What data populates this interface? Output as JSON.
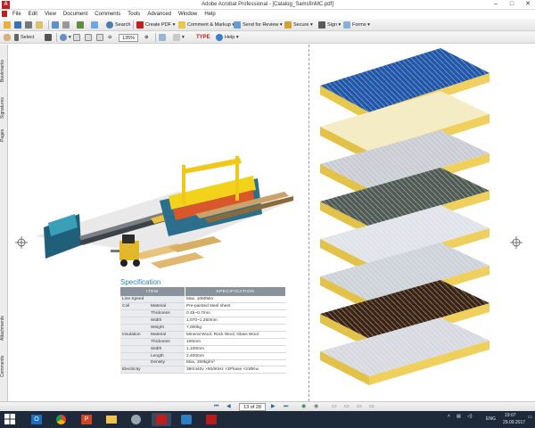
{
  "window": {
    "title": "Adobe Acrobat Professional - [Catalog_SamsfinMC.pdf]",
    "minimize": "–",
    "maximize": "□",
    "close": "✕"
  },
  "menu": [
    "File",
    "Edit",
    "View",
    "Document",
    "Comments",
    "Tools",
    "Advanced",
    "Window",
    "Help"
  ],
  "toolbar1": {
    "search": "Search",
    "create_pdf": "Create PDF",
    "comment_markup": "Comment & Markup",
    "send_for_review": "Send for Review",
    "secure": "Secure",
    "sign": "Sign",
    "forms": "Forms"
  },
  "toolbar2": {
    "select": "Select",
    "zoom": "135%",
    "help": "Help"
  },
  "left_tabs": [
    "Bookmarks",
    "Signatures",
    "Pages",
    "Attachments",
    "Comments"
  ],
  "spec": {
    "title": "Specification",
    "headers": [
      "ITEM",
      "SPECIFICATION"
    ],
    "rows": [
      [
        "Line Speed",
        "",
        "Max. 10M/Min"
      ],
      [
        "Coil",
        "Material",
        "Pre-painted steel sheet"
      ],
      [
        "",
        "Thickness",
        "0.45~0.7mm"
      ],
      [
        "",
        "Width",
        "1,070~1,250mm"
      ],
      [
        "",
        "Weight",
        "7,000kg"
      ],
      [
        "Insulation",
        "Material",
        "Mineral Wool, Rock Wool, Glass Wool"
      ],
      [
        "",
        "Thickness",
        "100mm"
      ],
      [
        "",
        "Width",
        "1,100mm"
      ],
      [
        "",
        "Length",
        "2,400mm"
      ],
      [
        "",
        "Density",
        "Max. 150kg/m³"
      ],
      [
        "Electricity",
        "",
        "380/440v ×50/60Hz ×3Phase ×230Kw"
      ]
    ]
  },
  "nav": {
    "page": "13 of 28"
  },
  "tray": {
    "lang": "ENG",
    "time": "19:07",
    "date": "29.09.2017"
  },
  "colors": {
    "spec_header": "#8a939b",
    "spec_title": "#2a7fb8",
    "taskbar": "#1e2a3a",
    "acrobat_red": "#c0201d"
  }
}
